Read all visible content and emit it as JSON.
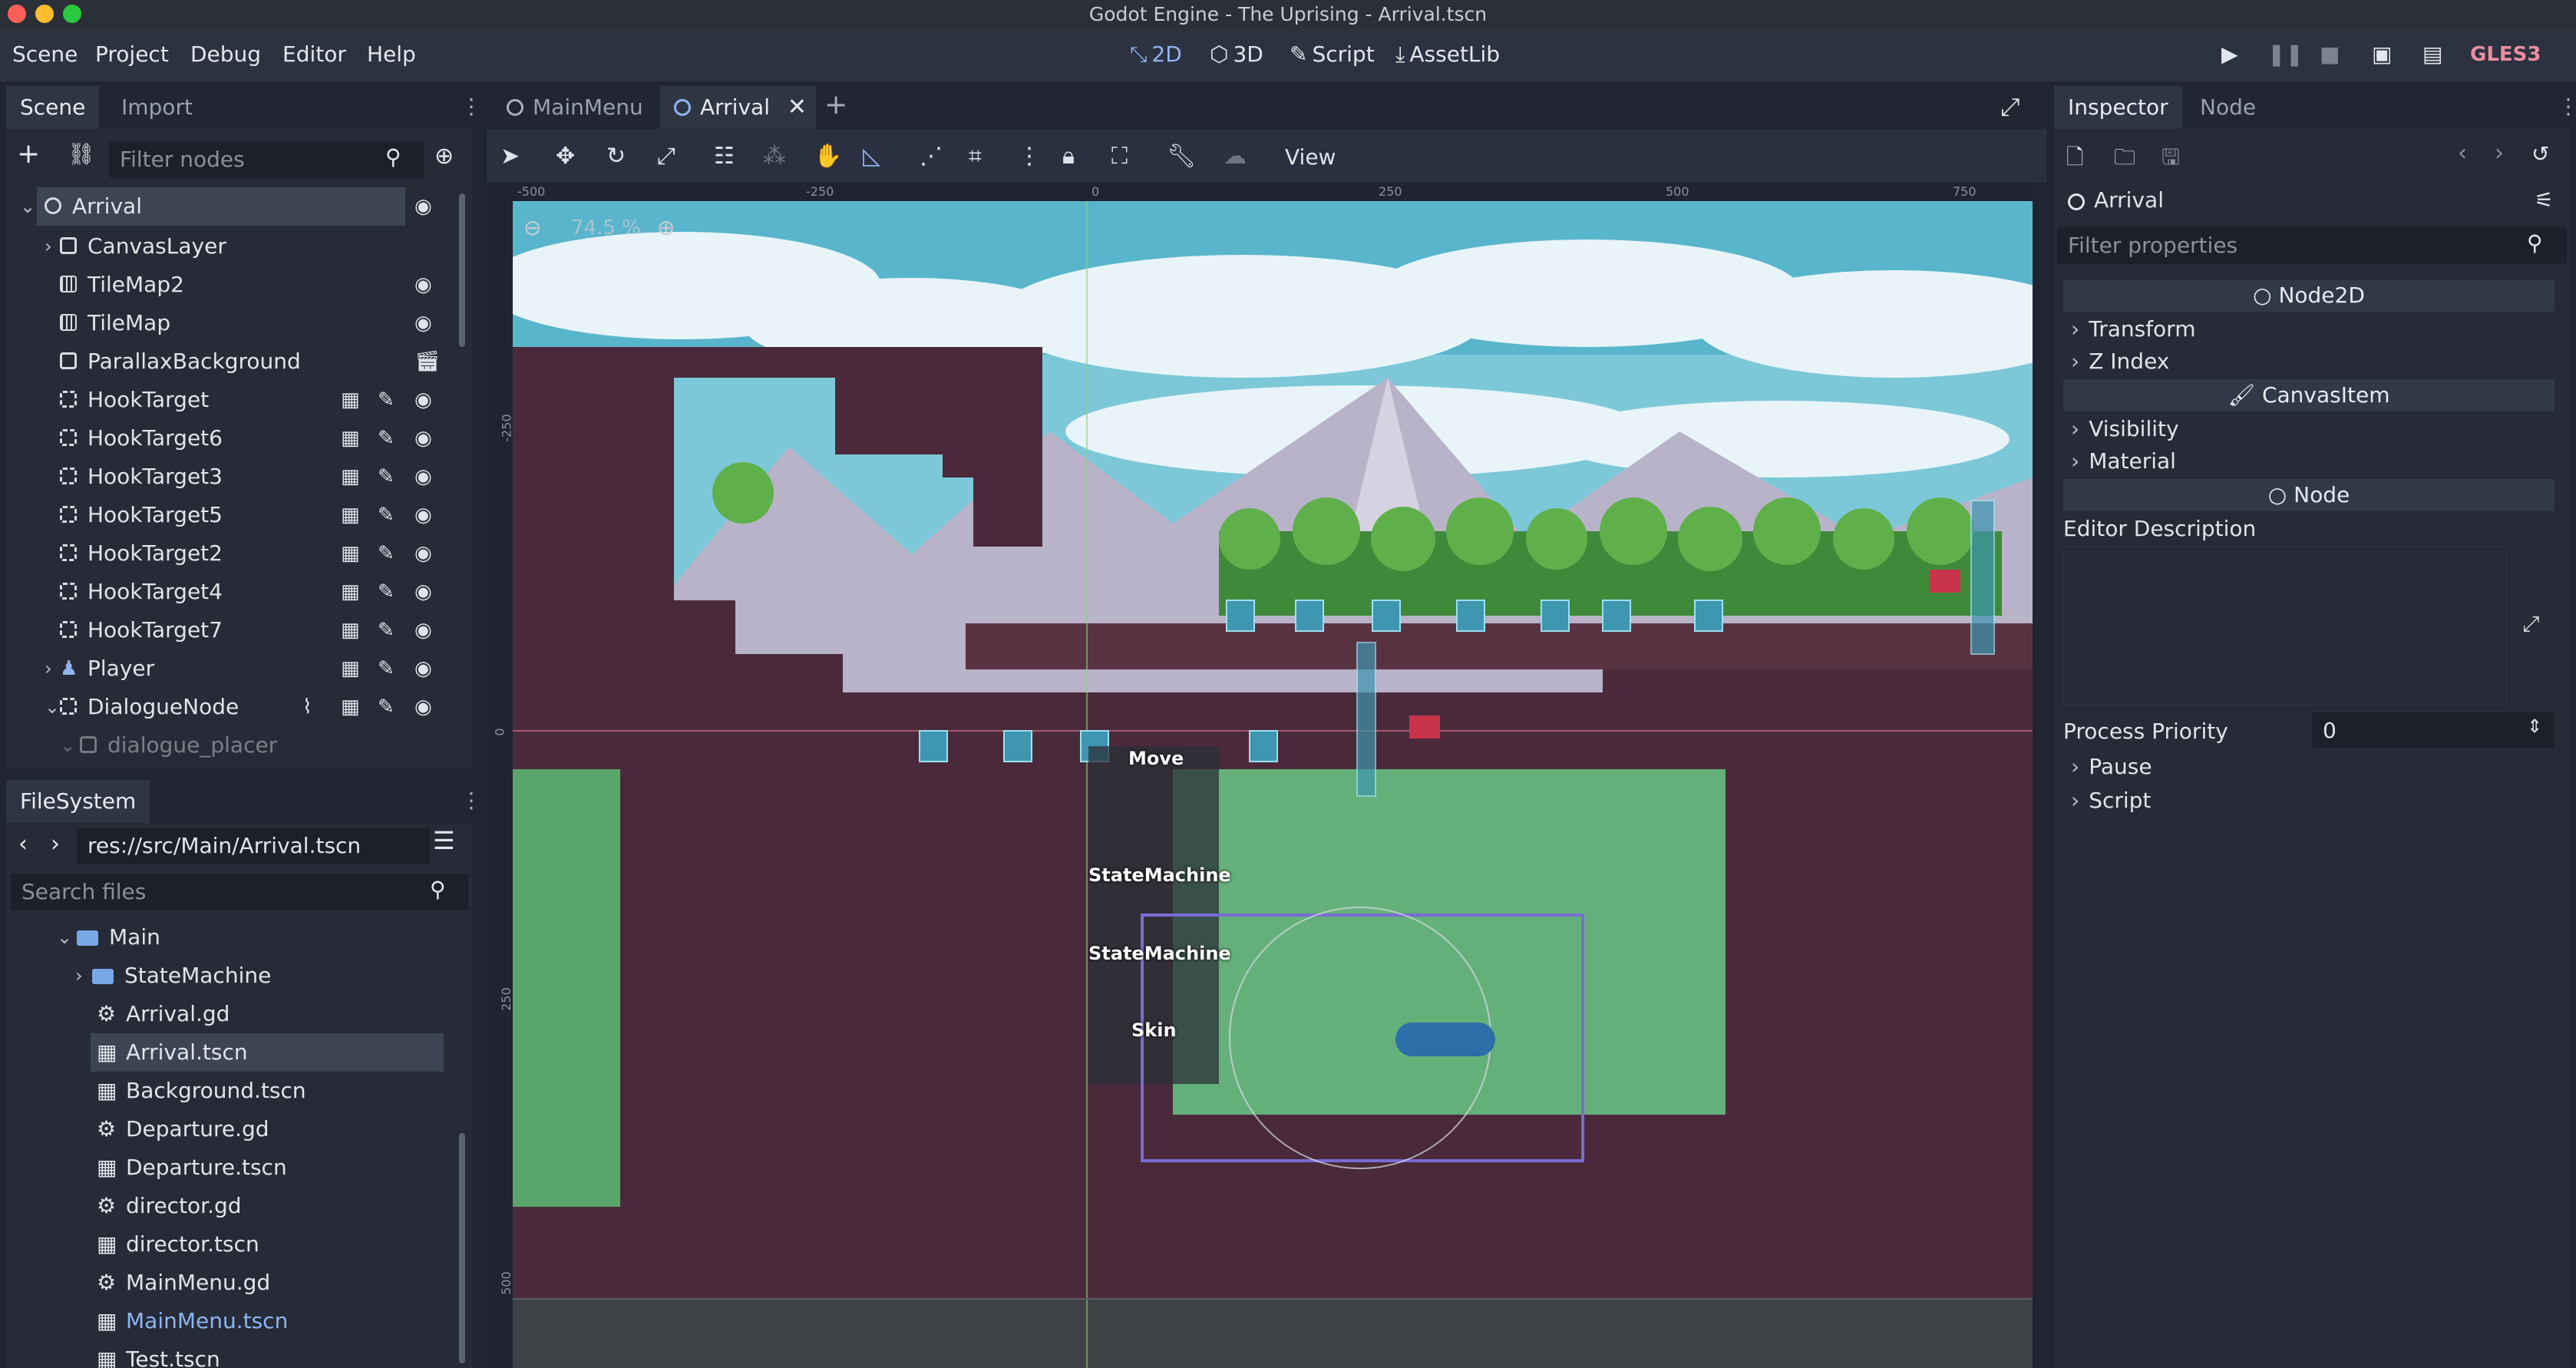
{
  "window": {
    "title": "Godot Engine - The Uprising - Arrival.tscn"
  },
  "menu": [
    "Scene",
    "Project",
    "Debug",
    "Editor",
    "Help"
  ],
  "workspaces": [
    {
      "label": "2D",
      "icon": "2d-icon",
      "active": true
    },
    {
      "label": "3D",
      "icon": "3d-icon",
      "active": false
    },
    {
      "label": "Script",
      "icon": "script-icon",
      "active": false
    },
    {
      "label": "AssetLib",
      "icon": "assetlib-icon",
      "active": false
    }
  ],
  "renderer": "GLES3",
  "scene_dock": {
    "tabs": [
      "Scene",
      "Import"
    ],
    "filter_placeholder": "Filter nodes",
    "nodes": [
      {
        "label": "Arrival",
        "icon": "node2d-icon",
        "selected": true,
        "expander": "open"
      },
      {
        "label": "CanvasLayer",
        "icon": "canvaslayer-icon",
        "expander": "closed"
      },
      {
        "label": "TileMap2",
        "icon": "tilemap-icon"
      },
      {
        "label": "TileMap",
        "icon": "tilemap-icon"
      },
      {
        "label": "ParallaxBackground",
        "icon": "parallax-icon"
      },
      {
        "label": "HookTarget",
        "icon": "hooktarget-icon"
      },
      {
        "label": "HookTarget6",
        "icon": "hooktarget-icon"
      },
      {
        "label": "HookTarget3",
        "icon": "hooktarget-icon"
      },
      {
        "label": "HookTarget5",
        "icon": "hooktarget-icon"
      },
      {
        "label": "HookTarget2",
        "icon": "hooktarget-icon"
      },
      {
        "label": "HookTarget4",
        "icon": "hooktarget-icon"
      },
      {
        "label": "HookTarget7",
        "icon": "hooktarget-icon"
      },
      {
        "label": "Player",
        "icon": "player-icon",
        "expander": "closed"
      },
      {
        "label": "DialogueNode",
        "icon": "dialoguenode-icon",
        "expander": "open"
      },
      {
        "label": "dialogue_placer",
        "icon": "edit-icon"
      }
    ]
  },
  "filesystem": {
    "tab": "FileSystem",
    "path": "res://src/Main/Arrival.tscn",
    "search_placeholder": "Search files",
    "items": [
      {
        "label": "Main",
        "type": "folder",
        "expander": "open"
      },
      {
        "label": "StateMachine",
        "type": "folder",
        "expander": "closed"
      },
      {
        "label": "Arrival.gd",
        "type": "script"
      },
      {
        "label": "Arrival.tscn",
        "type": "scene",
        "selected": true
      },
      {
        "label": "Background.tscn",
        "type": "scene"
      },
      {
        "label": "Departure.gd",
        "type": "script"
      },
      {
        "label": "Departure.tscn",
        "type": "scene"
      },
      {
        "label": "director.gd",
        "type": "script"
      },
      {
        "label": "director.tscn",
        "type": "scene"
      },
      {
        "label": "MainMenu.gd",
        "type": "script"
      },
      {
        "label": "MainMenu.tscn",
        "type": "scene",
        "highlight": true
      },
      {
        "label": "Test.tscn",
        "type": "scene"
      }
    ]
  },
  "editor_tabs": [
    {
      "label": "MainMenu",
      "active": false
    },
    {
      "label": "Arrival",
      "active": true
    }
  ],
  "toolbar": {
    "view_label": "View"
  },
  "viewport": {
    "zoom": "74.5 %",
    "ruler_top": [
      "-500",
      "-250",
      "0",
      "250",
      "500",
      "750"
    ],
    "ruler_left": [
      "-250",
      "0",
      "250",
      "500"
    ],
    "labels": [
      "Move",
      "StateMachine",
      "StateMachine",
      "Skin"
    ]
  },
  "inspector": {
    "tabs": [
      "Inspector",
      "Node"
    ],
    "node_name": "Arrival",
    "filter_placeholder": "Filter properties",
    "sections": [
      "Node2D",
      "CanvasItem",
      "Node"
    ],
    "node2d_props": [
      "Transform",
      "Z Index"
    ],
    "canvasitem_props": [
      "Visibility",
      "Material"
    ],
    "editor_description": "Editor Description",
    "process_priority_label": "Process Priority",
    "process_priority_value": "0",
    "node_props": [
      "Pause",
      "Script"
    ]
  },
  "colors": {
    "accent": "#8fb4f0",
    "gles": "#e98fa0",
    "bg": "#202531",
    "panel": "#262b37"
  }
}
